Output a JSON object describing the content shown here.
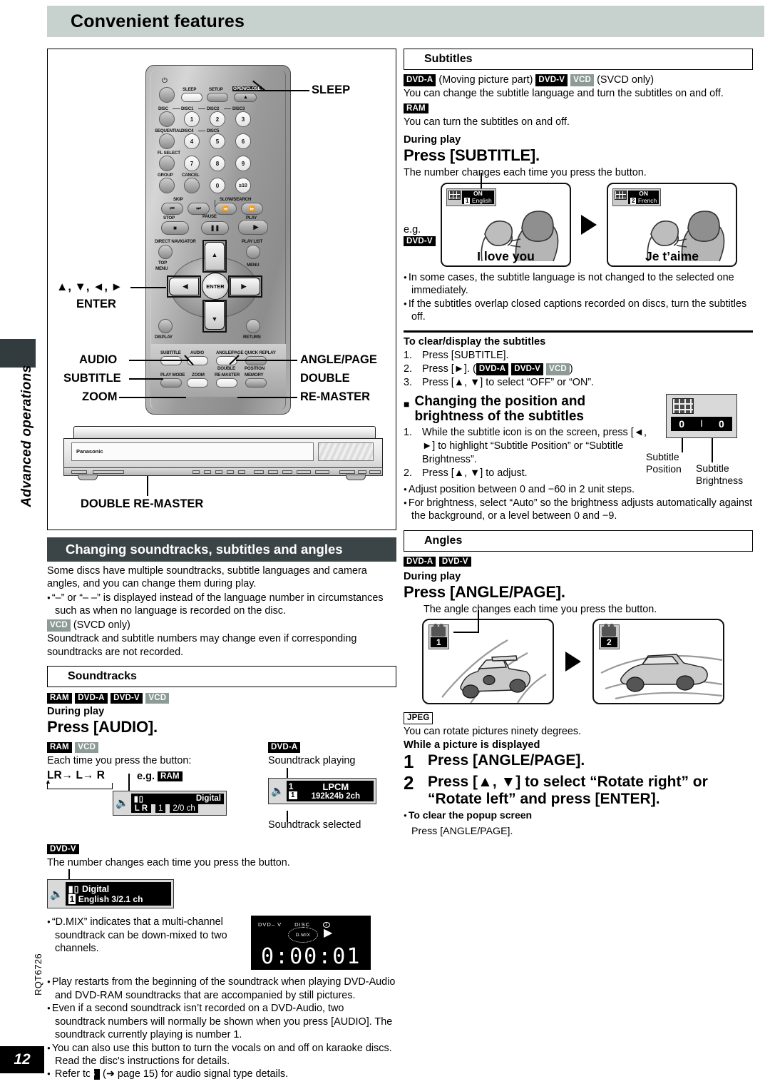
{
  "page": {
    "title": "Convenient features",
    "side_tab": "Advanced operations",
    "page_number": "12",
    "doc_code": "RQT6726"
  },
  "remote": {
    "callouts": {
      "sleep": "SLEEP",
      "arrows": "▲, ▼, ◄, ►",
      "enter": "ENTER",
      "audio": "AUDIO",
      "subtitle": "SUBTITLE",
      "zoom": "ZOOM",
      "angle_page": "ANGLE/PAGE",
      "double": "DOUBLE",
      "remaster": "RE-MASTER",
      "double_remaster": "DOUBLE RE-MASTER"
    },
    "buttons": {
      "power": "⏻",
      "sleep": "SLEEP",
      "setup": "SETUP",
      "open_close": "OPEN/CLOSE",
      "disc": "DISC",
      "disc1": "DISC1",
      "disc2": "DISC2",
      "disc3": "DISC3",
      "disc4": "DISC4",
      "disc5": "DISC5",
      "sequential": "SEQUENTIAL",
      "fl_select": "FL SELECT",
      "group": "GROUP",
      "cancel": "CANCEL",
      "n1": "1",
      "n2": "2",
      "n3": "3",
      "n4": "4",
      "n5": "5",
      "n6": "6",
      "n7": "7",
      "n8": "8",
      "n9": "9",
      "n0": "0",
      "n10": "≥10",
      "skip": "SKIP",
      "slow_search": "SLOW/SEARCH",
      "stop": "STOP",
      "pause": "PAUSE",
      "play": "PLAY",
      "direct_navigator": "DIRECT NAVIGATOR",
      "play_list": "PLAY LIST",
      "top_menu": "TOP\nMENU",
      "menu": "MENU",
      "display": "DISPLAY",
      "return": "RETURN",
      "enter": "ENTER",
      "subtitle": "SUBTITLE",
      "audio": "AUDIO",
      "angle_page": "ANGLE/PAGE",
      "quick_replay": "QUICK REPLAY",
      "play_mode": "PLAY MODE",
      "zoom": "ZOOM",
      "double_remaster": "DOUBLE\nRE-MASTER",
      "position_memory": "POSITION\nMEMORY"
    },
    "player_brand": "Panasonic"
  },
  "left": {
    "section_banner": "Changing soundtracks, subtitles and angles",
    "intro_p1": "Some discs have multiple soundtracks, subtitle languages and camera angles, and you can change them during play.",
    "intro_b1": "“–” or “– –” is displayed instead of the language number in circumstances such as when no language is recorded on the disc.",
    "vcd_tag": "VCD",
    "vcd_note": "(SVCD only)",
    "intro_p2": "Soundtrack and subtitle numbers may change even if corresponding soundtracks are not recorded.",
    "soundtracks_banner": "Soundtracks",
    "tags_row": [
      "RAM",
      "DVD-A",
      "DVD-V",
      "VCD"
    ],
    "during_play": "During play",
    "press_audio": "Press [AUDIO].",
    "ram_vcd_tags": [
      "RAM",
      "VCD"
    ],
    "each_time": "Each time you press the button:",
    "lr_cycle": "LR→ L→ R",
    "eg_label": "e.g.",
    "eg_tag": "RAM",
    "osd_ram": {
      "lr": "L R",
      "num": "1",
      "format": "Digital",
      "channels": "2/0  ch"
    },
    "dvda_tag": "DVD-A",
    "soundtrack_playing": "Soundtrack playing",
    "soundtrack_selected": "Soundtrack selected",
    "osd_dvda": {
      "num_top": "1",
      "num_box": "1",
      "format": "LPCM",
      "spec": "192k24b 2ch"
    },
    "dvdv_tag": "DVD-V",
    "dvdv_note": "The number changes each time you press the button.",
    "osd_dvdv": {
      "num": "1",
      "format": "Digital",
      "lang": "English  3/2.1 ch"
    },
    "fl_display": {
      "disc_label": "DISC",
      "dvd_label": "DVD– V",
      "disc_num": "1",
      "dmix": "D.MIX",
      "time": "0:00:01"
    },
    "bullets": [
      "“D.MIX” indicates that a multi-channel soundtrack can be down-mixed to two channels.",
      "Play restarts from the beginning of the soundtrack when playing DVD-Audio and DVD-RAM soundtracks that are accompanied by still pictures.",
      "Even if a second soundtrack isn’t recorded on a DVD-Audio, two soundtrack numbers will normally be shown when you press [AUDIO]. The soundtrack currently playing is number 1.",
      "You can also use this button to turn the vocals on and off on karaoke discs. Read the disc's instructions for details."
    ],
    "refer_prefix": "Refer to",
    "refer_tag": "B",
    "refer_suffix": "(➜ page 15) for audio signal type details."
  },
  "right": {
    "subtitles_banner": "Subtitles",
    "tag_dvda": "DVD-A",
    "moving_picture": "(Moving picture part)",
    "tag_dvdv": "DVD-V",
    "tag_vcd": "VCD",
    "svcd_only": "(SVCD only)",
    "sub_line1": "You can change the subtitle language and turn the subtitles on and off.",
    "tag_ram": "RAM",
    "sub_line2": "You can turn the subtitles on and off.",
    "during_play": "During play",
    "press_subtitle": "Press [SUBTITLE].",
    "number_changes": "The number changes each time you press the button.",
    "eg_label": "e.g.",
    "eg_tag": "DVD-V",
    "tv_left": {
      "on": "ON",
      "num": "1",
      "lang": "English",
      "caption": "I love you"
    },
    "tv_right": {
      "on": "ON",
      "num": "2",
      "lang": "French",
      "caption": "Je t’aime"
    },
    "bullets": [
      "In some cases, the subtitle language is not changed to the selected one immediately.",
      "If the subtitles overlap closed captions recorded on discs, turn the subtitles off."
    ],
    "clear_heading": "To clear/display the subtitles",
    "clear_steps": [
      {
        "n": "1.",
        "text": "Press [SUBTITLE]."
      },
      {
        "n": "2.",
        "text_before": "Press [►]. (",
        "tags": [
          "DVD-A",
          "DVD-V",
          "VCD"
        ],
        "text_after": ")"
      },
      {
        "n": "3.",
        "text": "Press [▲, ▼] to select “OFF” or “ON”."
      }
    ],
    "position_heading_l1": "Changing the position and",
    "position_heading_l2": "brightness of the subtitles",
    "position_steps": [
      {
        "n": "1.",
        "text": "While the subtitle icon is on the screen, press [◄, ►] to highlight “Subtitle Position” or “Subtitle Brightness”."
      },
      {
        "n": "2.",
        "text": "Press [▲, ▼] to adjust."
      }
    ],
    "osd_position_value": "0",
    "osd_brightness_value": "0",
    "label_subtitle_position_l1": "Subtitle",
    "label_subtitle_position_l2": "Position",
    "label_subtitle_brightness_l1": "Subtitle",
    "label_subtitle_brightness_l2": "Brightness",
    "position_bullets": [
      "Adjust position between 0 and −60 in 2 unit steps.",
      "For brightness, select “Auto” so the brightness adjusts automatically against the background, or a level between 0 and −9."
    ],
    "angles_banner": "Angles",
    "angles_tags": [
      "DVD-A",
      "DVD-V"
    ],
    "angles_during_play": "During play",
    "press_angle": "Press [ANGLE/PAGE].",
    "angle_changes": "The angle changes each time you press the button.",
    "car_left_num": "1",
    "car_right_num": "2",
    "tag_jpeg": "JPEG",
    "jpeg_note": "You can rotate pictures ninety degrees.",
    "while_displayed": "While a picture is displayed",
    "big_steps": [
      {
        "n": "1",
        "text": "Press [ANGLE/PAGE]."
      },
      {
        "n": "2",
        "text": "Press [▲, ▼] to select “Rotate right” or “Rotate left” and press [ENTER]."
      }
    ],
    "clear_popup_bullet": "To clear the popup screen",
    "clear_popup_text": "Press [ANGLE/PAGE]."
  }
}
